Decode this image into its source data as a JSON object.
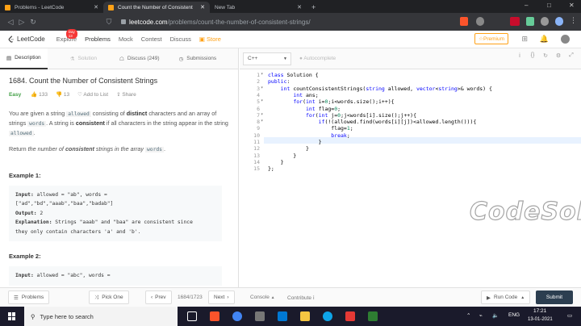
{
  "browser": {
    "tabs": [
      {
        "title": "Problems - LeetCode",
        "active": false
      },
      {
        "title": "Count the Number of Consistent",
        "active": true
      },
      {
        "title": "New Tab",
        "active": false
      }
    ],
    "url_host": "leetcode.com",
    "url_path": "/problems/count-the-number-of-consistent-strings/"
  },
  "nav": {
    "logo": "LeetCode",
    "items": [
      "Explore",
      "Problems",
      "Mock",
      "Contest",
      "Discuss",
      "Store"
    ],
    "explore_badge": "Day 13",
    "premium": "Premium"
  },
  "left_tabs": [
    "Description",
    "Solution",
    "Discuss (249)",
    "Submissions"
  ],
  "problem": {
    "title": "1684. Count the Number of Consistent Strings",
    "difficulty": "Easy",
    "likes": "133",
    "dislikes": "13",
    "add_to_list": "Add to List",
    "share": "Share",
    "desc1_a": "You are given a string ",
    "desc1_code1": "allowed",
    "desc1_b": " consisting of ",
    "desc1_bold": "distinct",
    "desc1_c": " characters and an array of strings ",
    "desc1_code2": "words",
    "desc1_d": ". A string is ",
    "desc1_bold2": "consistent",
    "desc1_e": " if all characters in the string appear in the string ",
    "desc1_code3": "allowed",
    "desc1_f": ".",
    "desc2_a": "Return ",
    "desc2_italic": "the number of ",
    "desc2_bold": "consistent",
    "desc2_italic2": " strings in the array ",
    "desc2_code": "words",
    "desc2_f": ".",
    "example1_title": "Example 1:",
    "example1_input_label": "Input:",
    "example1_input": " allowed = \"ab\", words =",
    "example1_input2": "[\"ad\",\"bd\",\"aaab\",\"baa\",\"badab\"]",
    "example1_output_label": "Output:",
    "example1_output": " 2",
    "example1_expl_label": "Explanation:",
    "example1_expl": " Strings \"aaab\" and \"baa\" are consistent since",
    "example1_expl2": "they only contain characters 'a' and 'b'.",
    "example2_title": "Example 2:",
    "example2_input_label": "Input:",
    "example2_input": " allowed = \"abc\", words ="
  },
  "editor": {
    "language": "C++",
    "autocomplete": "Autocomplete",
    "lines": [
      "class Solution {",
      "public:",
      "    int countConsistentStrings(string allowed, vector<string>& words) {",
      "        int ans;",
      "        for(int i=0;i<words.size();i++){",
      "            int flag=0;",
      "            for(int j=0;j<words[i].size();j++){",
      "                if(!(allowed.find(words[i][j])<allowed.length())){",
      "                    flag=1;",
      "                    break;",
      "                }",
      "            }",
      "        }",
      "    }",
      "};"
    ],
    "watermark": "CodeSol"
  },
  "bottom": {
    "problems": "Problems",
    "pick_one": "Pick One",
    "prev": "Prev",
    "page": "1684/1723",
    "next": "Next",
    "console": "Console",
    "contribute": "Contribute",
    "run_code": "Run Code",
    "submit": "Submit"
  },
  "taskbar": {
    "search_placeholder": "Type here to search",
    "lang": "ENG",
    "time": "17:21",
    "date": "13-01-2021"
  }
}
